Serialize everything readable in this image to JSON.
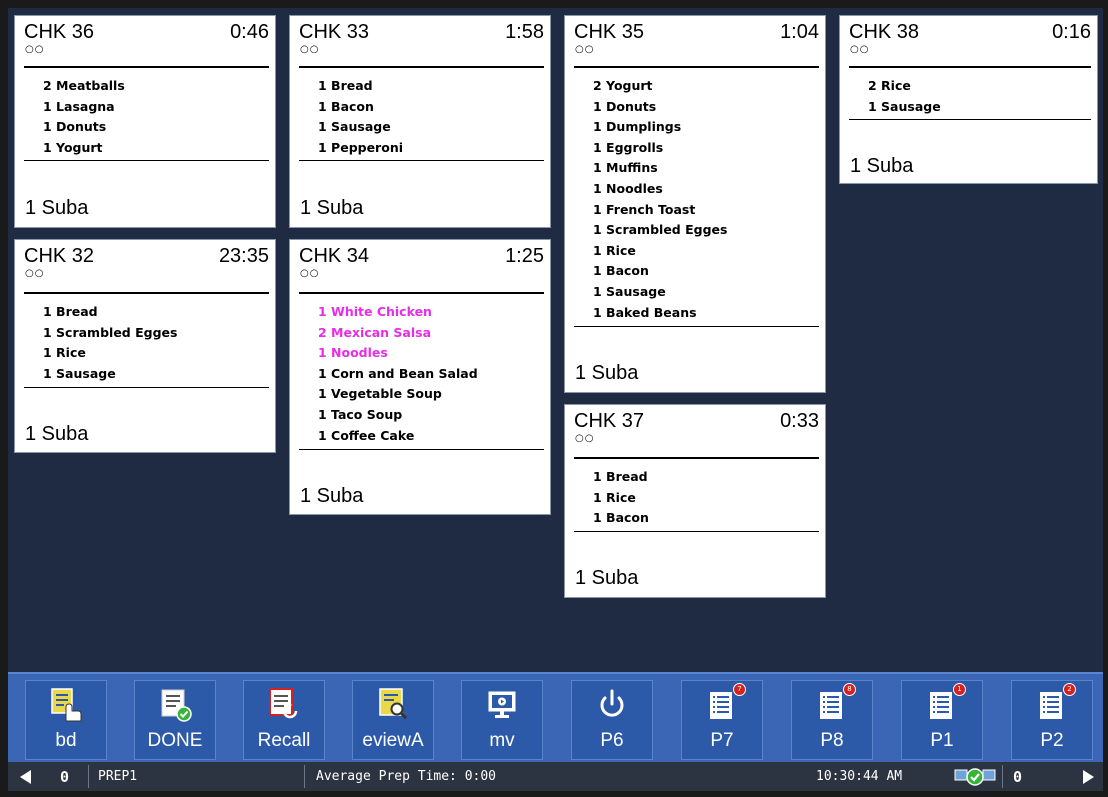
{
  "tickets": [
    {
      "title": "CHK 36",
      "time": "0:46",
      "dots": "○○",
      "items": [
        "2 Meatballs",
        "1 Lasagna",
        "1 Donuts",
        "1 Yogurt"
      ],
      "footer": "1 Suba"
    },
    {
      "title": "CHK 33",
      "time": "1:58",
      "dots": "○○",
      "items": [
        "1 Bread",
        "1 Bacon",
        "1 Sausage",
        "1 Pepperoni"
      ],
      "footer": "1 Suba"
    },
    {
      "title": "CHK 35",
      "time": "1:04",
      "dots": "○○",
      "items": [
        "2 Yogurt",
        "1 Donuts",
        "1 Dumplings",
        "1 Eggrolls",
        "1 Muffins",
        "1 Noodles",
        "1 French Toast",
        "1 Scrambled Egges",
        "1 Rice",
        "1 Bacon",
        "1 Sausage",
        "1 Baked Beans"
      ],
      "footer": "1 Suba"
    },
    {
      "title": "CHK 38",
      "time": "0:16",
      "dots": "○○",
      "items": [
        "2 Rice",
        "1 Sausage"
      ],
      "footer": "1 Suba"
    },
    {
      "title": "CHK 32",
      "time": "23:35",
      "dots": "○○",
      "items": [
        "1 Bread",
        "1 Scrambled Egges",
        "1 Rice",
        "1 Sausage"
      ],
      "footer": "1 Suba"
    },
    {
      "title": "CHK 34",
      "time": "1:25",
      "dots": "○○",
      "items": [
        "1 White Chicken",
        "2 Mexican Salsa",
        "1 Noodles",
        "1 Corn and Bean Salad",
        "1 Vegetable Soup",
        "1 Taco Soup",
        "1 Coffee Cake"
      ],
      "modified_items": [
        0,
        1,
        2
      ],
      "footer": "1 Suba"
    },
    {
      "title": "CHK 37",
      "time": "0:33",
      "dots": "○○",
      "items": [
        "1 Bread",
        "1 Rice",
        "1 Bacon"
      ],
      "footer": "1 Suba"
    }
  ],
  "toolbar": [
    {
      "label": "bd",
      "icon": "touch-order-icon"
    },
    {
      "label": "DONE",
      "icon": "done-check-icon"
    },
    {
      "label": "Recall",
      "icon": "recall-icon"
    },
    {
      "label": "eviewA",
      "icon": "review-icon"
    },
    {
      "label": "mv",
      "icon": "monitor-icon"
    },
    {
      "label": "P6",
      "icon": "power-icon"
    },
    {
      "label": "P7",
      "icon": "order-list-icon",
      "badge": "7"
    },
    {
      "label": "P8",
      "icon": "order-list-icon",
      "badge": "8"
    },
    {
      "label": "P1",
      "icon": "order-list-icon",
      "badge": "1"
    },
    {
      "label": "P2",
      "icon": "order-list-icon",
      "badge": "2"
    }
  ],
  "status": {
    "left_count": "0",
    "station": "PREP1",
    "avg_prep": "Average Prep Time: 0:00",
    "clock": "10:30:44 AM",
    "right_count": "0"
  },
  "colors": {
    "screen_bg": "#1e2b42",
    "toolbar_bg": "#3a66b5",
    "modifier_text": "#e62ee6",
    "status_bg": "#2d3441"
  }
}
